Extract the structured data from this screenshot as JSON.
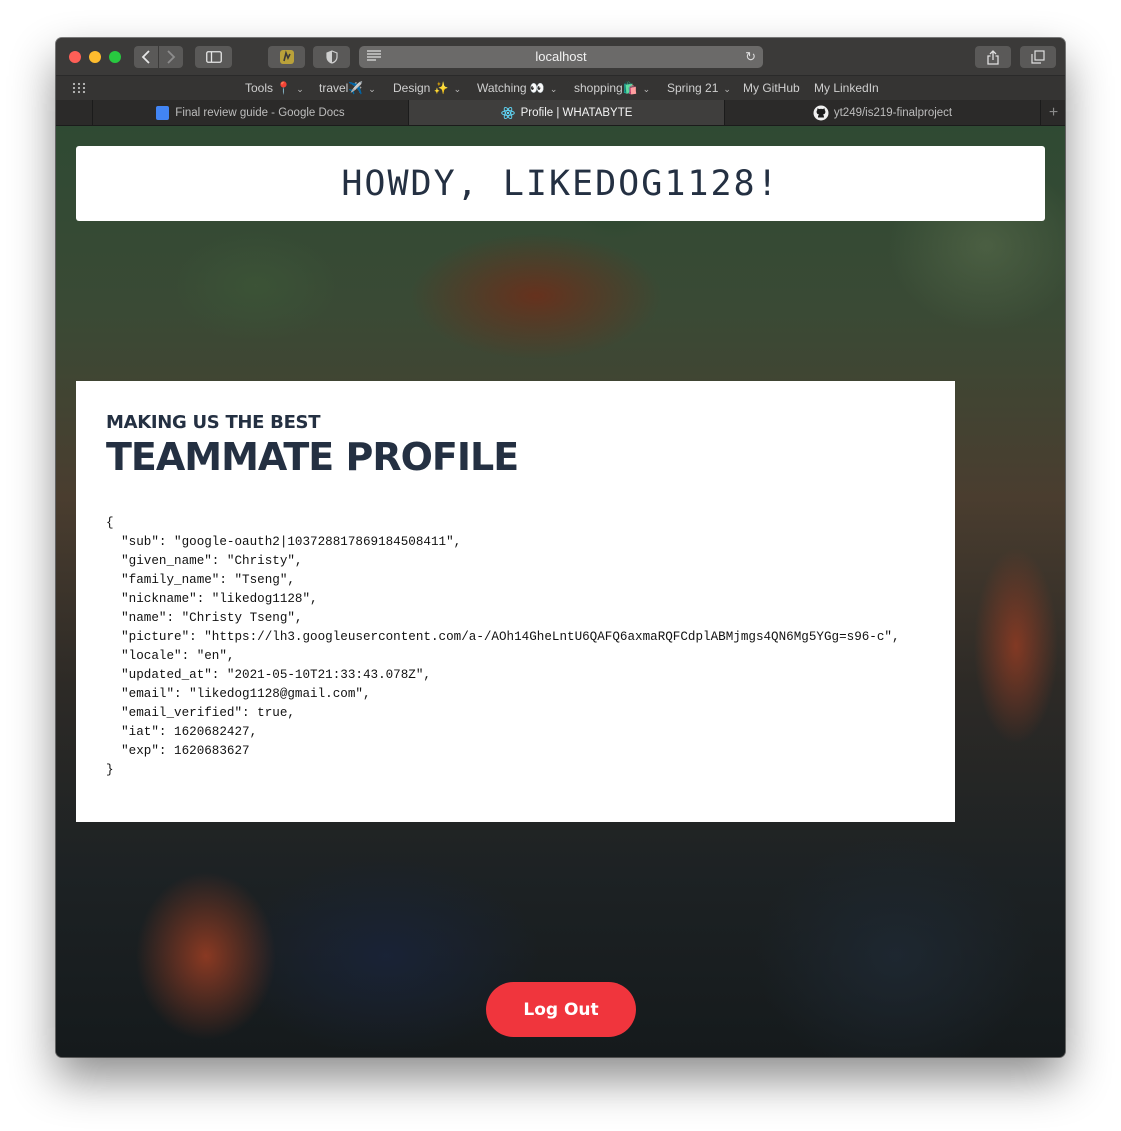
{
  "browser": {
    "address": "localhost",
    "favorites": [
      "Tools 📍",
      "travel✈️",
      "Design ✨",
      "Watching 👀",
      "shopping🛍️",
      "Spring 21",
      "My GitHub",
      "My LinkedIn"
    ],
    "tabs": [
      {
        "title": "Final review guide - Google Docs",
        "active": false
      },
      {
        "title": "Profile | WHATABYTE",
        "active": true
      },
      {
        "title": "yt249/is219-finalproject",
        "active": false
      }
    ]
  },
  "page": {
    "greeting": "HOWDY, LIKEDOG1128!",
    "kicker": "MAKING US THE BEST",
    "title": "TEAMMATE PROFILE",
    "profile_json": "{\n  \"sub\": \"google-oauth2|103728817869184508411\",\n  \"given_name\": \"Christy\",\n  \"family_name\": \"Tseng\",\n  \"nickname\": \"likedog1128\",\n  \"name\": \"Christy Tseng\",\n  \"picture\": \"https://lh3.googleusercontent.com/a-/AOh14GheLntU6QAFQ6axmaRQFCdplABMjmgs4QN6Mg5YGg=s96-c\",\n  \"locale\": \"en\",\n  \"updated_at\": \"2021-05-10T21:33:43.078Z\",\n  \"email\": \"likedog1128@gmail.com\",\n  \"email_verified\": true,\n  \"iat\": 1620682427,\n  \"exp\": 1620683627\n}",
    "logout_label": "Log Out"
  },
  "colors": {
    "accent_red": "#f0353d",
    "heading_navy": "#243042"
  }
}
